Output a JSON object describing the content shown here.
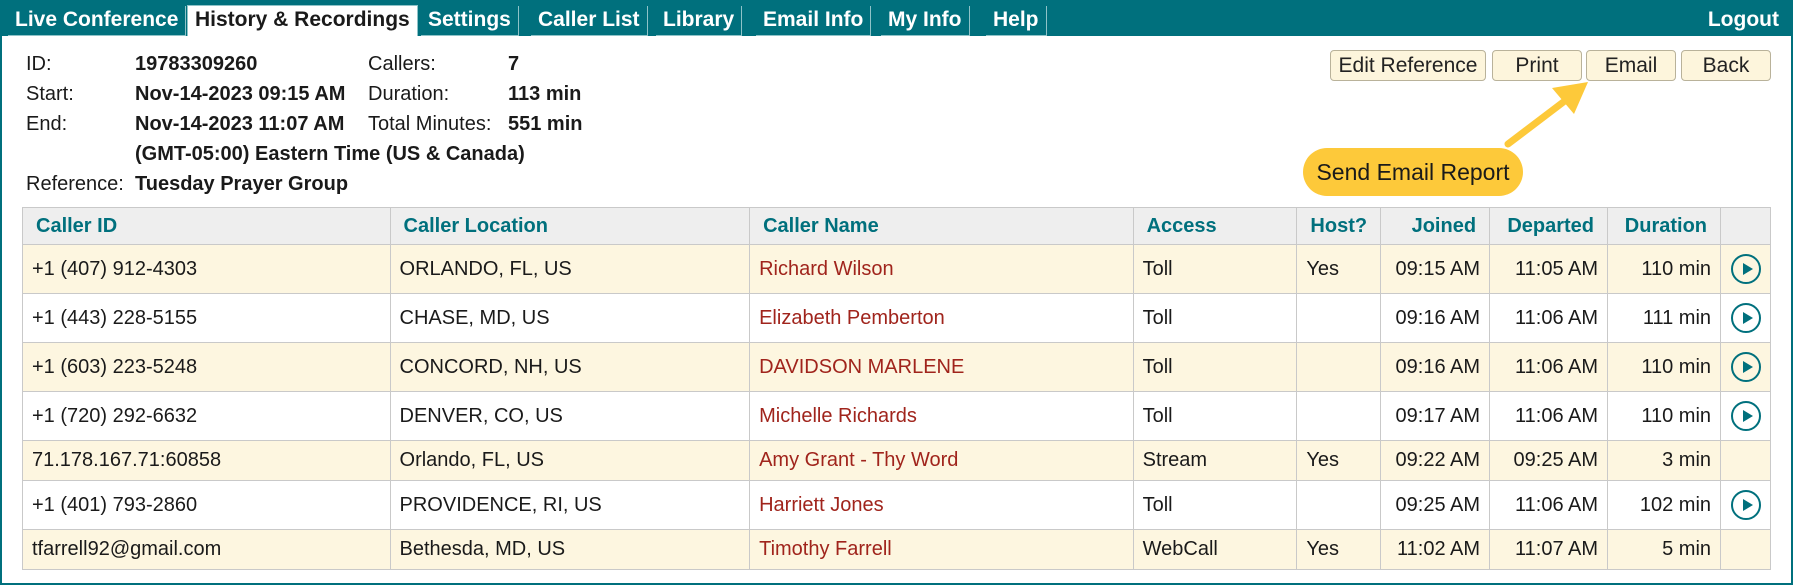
{
  "nav": {
    "items": [
      {
        "label": "Live Conference"
      },
      {
        "label": "History & Recordings",
        "active": true
      },
      {
        "label": "Settings"
      },
      {
        "label": "Caller List"
      },
      {
        "label": "Library"
      },
      {
        "label": "Email Info"
      },
      {
        "label": "My Info"
      },
      {
        "label": "Help"
      }
    ],
    "logout": "Logout"
  },
  "conference": {
    "id_label": "ID:",
    "id": "19783309260",
    "start_label": "Start:",
    "start": "Nov-14-2023 09:15 AM",
    "end_label": "End:",
    "end": "Nov-14-2023 11:07 AM",
    "timezone": "(GMT-05:00) Eastern Time (US & Canada)",
    "reference_label": "Reference:",
    "reference": "Tuesday Prayer Group",
    "callers_label": "Callers:",
    "callers": "7",
    "duration_label": "Duration:",
    "duration": "113 min",
    "total_label": "Total Minutes:",
    "total": "551 min"
  },
  "buttons": {
    "edit_reference": "Edit Reference",
    "print": "Print",
    "email": "Email",
    "back": "Back"
  },
  "callout": {
    "text": "Send Email Report",
    "color": "#fdc93a"
  },
  "table": {
    "headers": {
      "caller_id": "Caller ID",
      "location": "Caller Location",
      "name": "Caller Name",
      "access": "Access",
      "host": "Host?",
      "joined": "Joined",
      "departed": "Departed",
      "duration": "Duration"
    },
    "rows": [
      {
        "caller_id": "+1 (407) 912-4303",
        "location": "ORLANDO, FL, US",
        "name": "Richard Wilson",
        "access": "Toll",
        "host": "Yes",
        "joined": "09:15 AM",
        "departed": "11:05 AM",
        "duration": "110 min",
        "play": true
      },
      {
        "caller_id": "+1 (443) 228-5155",
        "location": "CHASE, MD, US",
        "name": "Elizabeth Pemberton",
        "access": "Toll",
        "host": "",
        "joined": "09:16 AM",
        "departed": "11:06 AM",
        "duration": "111 min",
        "play": true
      },
      {
        "caller_id": "+1 (603) 223-5248",
        "location": "CONCORD, NH, US",
        "name": "DAVIDSON MARLENE",
        "access": "Toll",
        "host": "",
        "joined": "09:16 AM",
        "departed": "11:06 AM",
        "duration": "110 min",
        "play": true
      },
      {
        "caller_id": "+1 (720) 292-6632",
        "location": "DENVER, CO, US",
        "name": "Michelle Richards",
        "access": "Toll",
        "host": "",
        "joined": "09:17 AM",
        "departed": "11:06 AM",
        "duration": "110 min",
        "play": true
      },
      {
        "caller_id": "71.178.167.71:60858",
        "location": "Orlando, FL, US",
        "name": "Amy Grant - Thy Word",
        "access": "Stream",
        "host": "Yes",
        "joined": "09:22 AM",
        "departed": "09:25 AM",
        "duration": "3 min",
        "play": false
      },
      {
        "caller_id": "+1 (401) 793-2860",
        "location": "PROVIDENCE, RI, US",
        "name": "Harriett Jones",
        "access": "Toll",
        "host": "",
        "joined": "09:25 AM",
        "departed": "11:06 AM",
        "duration": "102 min",
        "play": true
      },
      {
        "caller_id": "tfarrell92@gmail.com",
        "location": "Bethesda, MD, US",
        "name": "Timothy Farrell",
        "access": "WebCall",
        "host": "Yes",
        "joined": "11:02 AM",
        "departed": "11:07 AM",
        "duration": "5 min",
        "play": false
      }
    ]
  },
  "colors": {
    "accent": "#00707d",
    "row_alt": "#fdf6e0",
    "name_text": "#a0241c"
  }
}
